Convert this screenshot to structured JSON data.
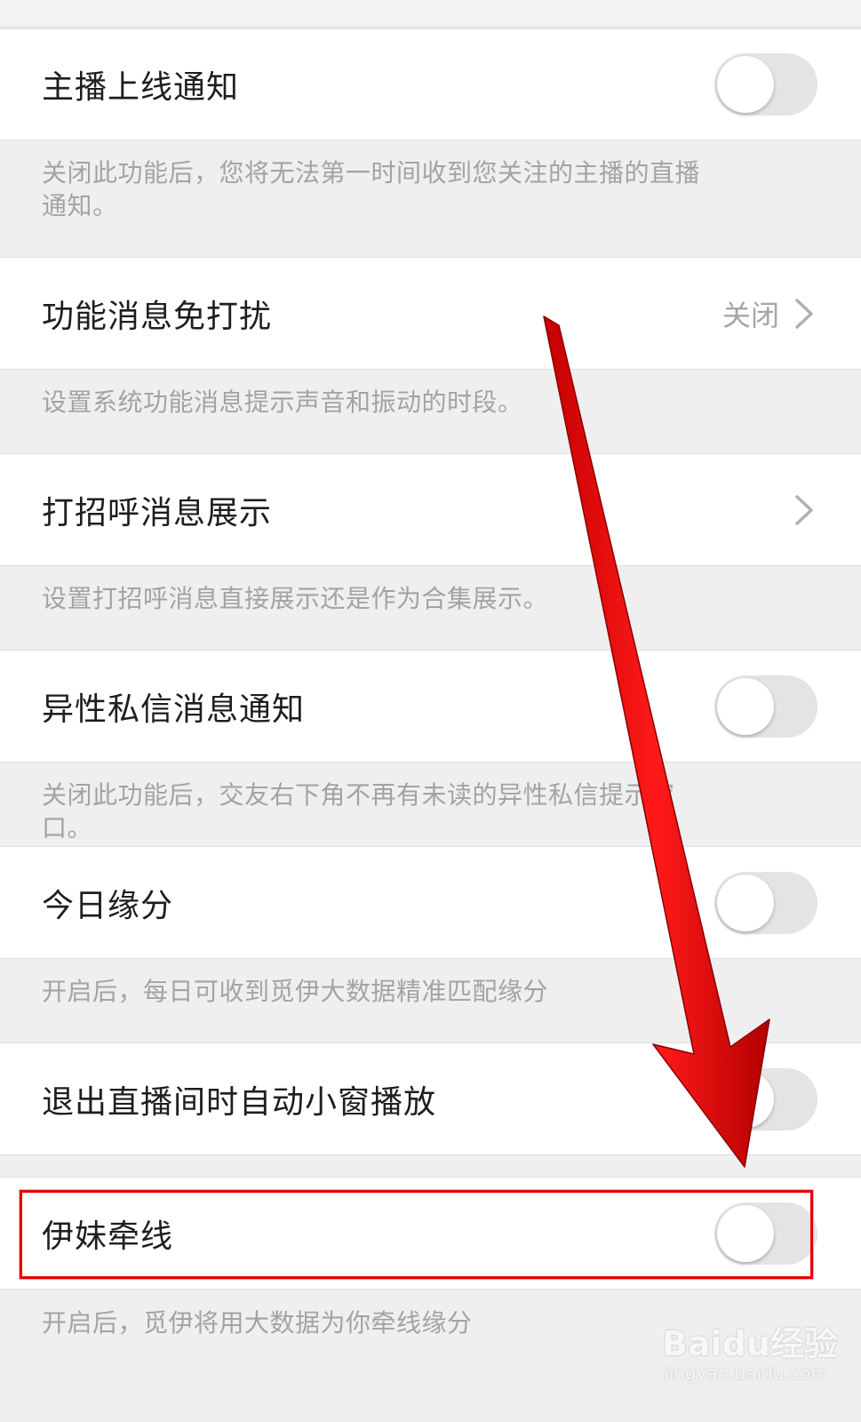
{
  "settings": [
    {
      "title": "主播上线通知",
      "type": "toggle",
      "on": false,
      "description": "关闭此功能后，您将无法第一时间收到您关注的主播的直播通知。"
    },
    {
      "title": "功能消息免打扰",
      "type": "link",
      "value": "关闭",
      "description": "设置系统功能消息提示声音和振动的时段。"
    },
    {
      "title": "打招呼消息展示",
      "type": "link",
      "value": "",
      "description": "设置打招呼消息直接展示还是作为合集展示。"
    },
    {
      "title": "异性私信消息通知",
      "type": "toggle",
      "on": false,
      "description": "关闭此功能后，交友右下角不再有未读的异性私信提示窗口。"
    },
    {
      "title": "今日缘分",
      "type": "toggle",
      "on": false,
      "description": "开启后，每日可收到觅伊大数据精准匹配缘分"
    },
    {
      "title": "退出直播间时自动小窗播放",
      "type": "toggle",
      "on": false,
      "description": ""
    },
    {
      "title": "伊妹牵线",
      "type": "toggle",
      "on": false,
      "description": "开启后，觅伊将用大数据为你牵线缘分",
      "highlighted": true
    }
  ],
  "icons": {
    "chevron": "chevron-right-icon"
  },
  "colors": {
    "annotation_red": "#e50000",
    "toggle_off": "#e4e4e4",
    "description_text": "#a3a3a3"
  },
  "watermark": {
    "brand": "Baidu经验",
    "url": "jingyan.baidu.com"
  }
}
